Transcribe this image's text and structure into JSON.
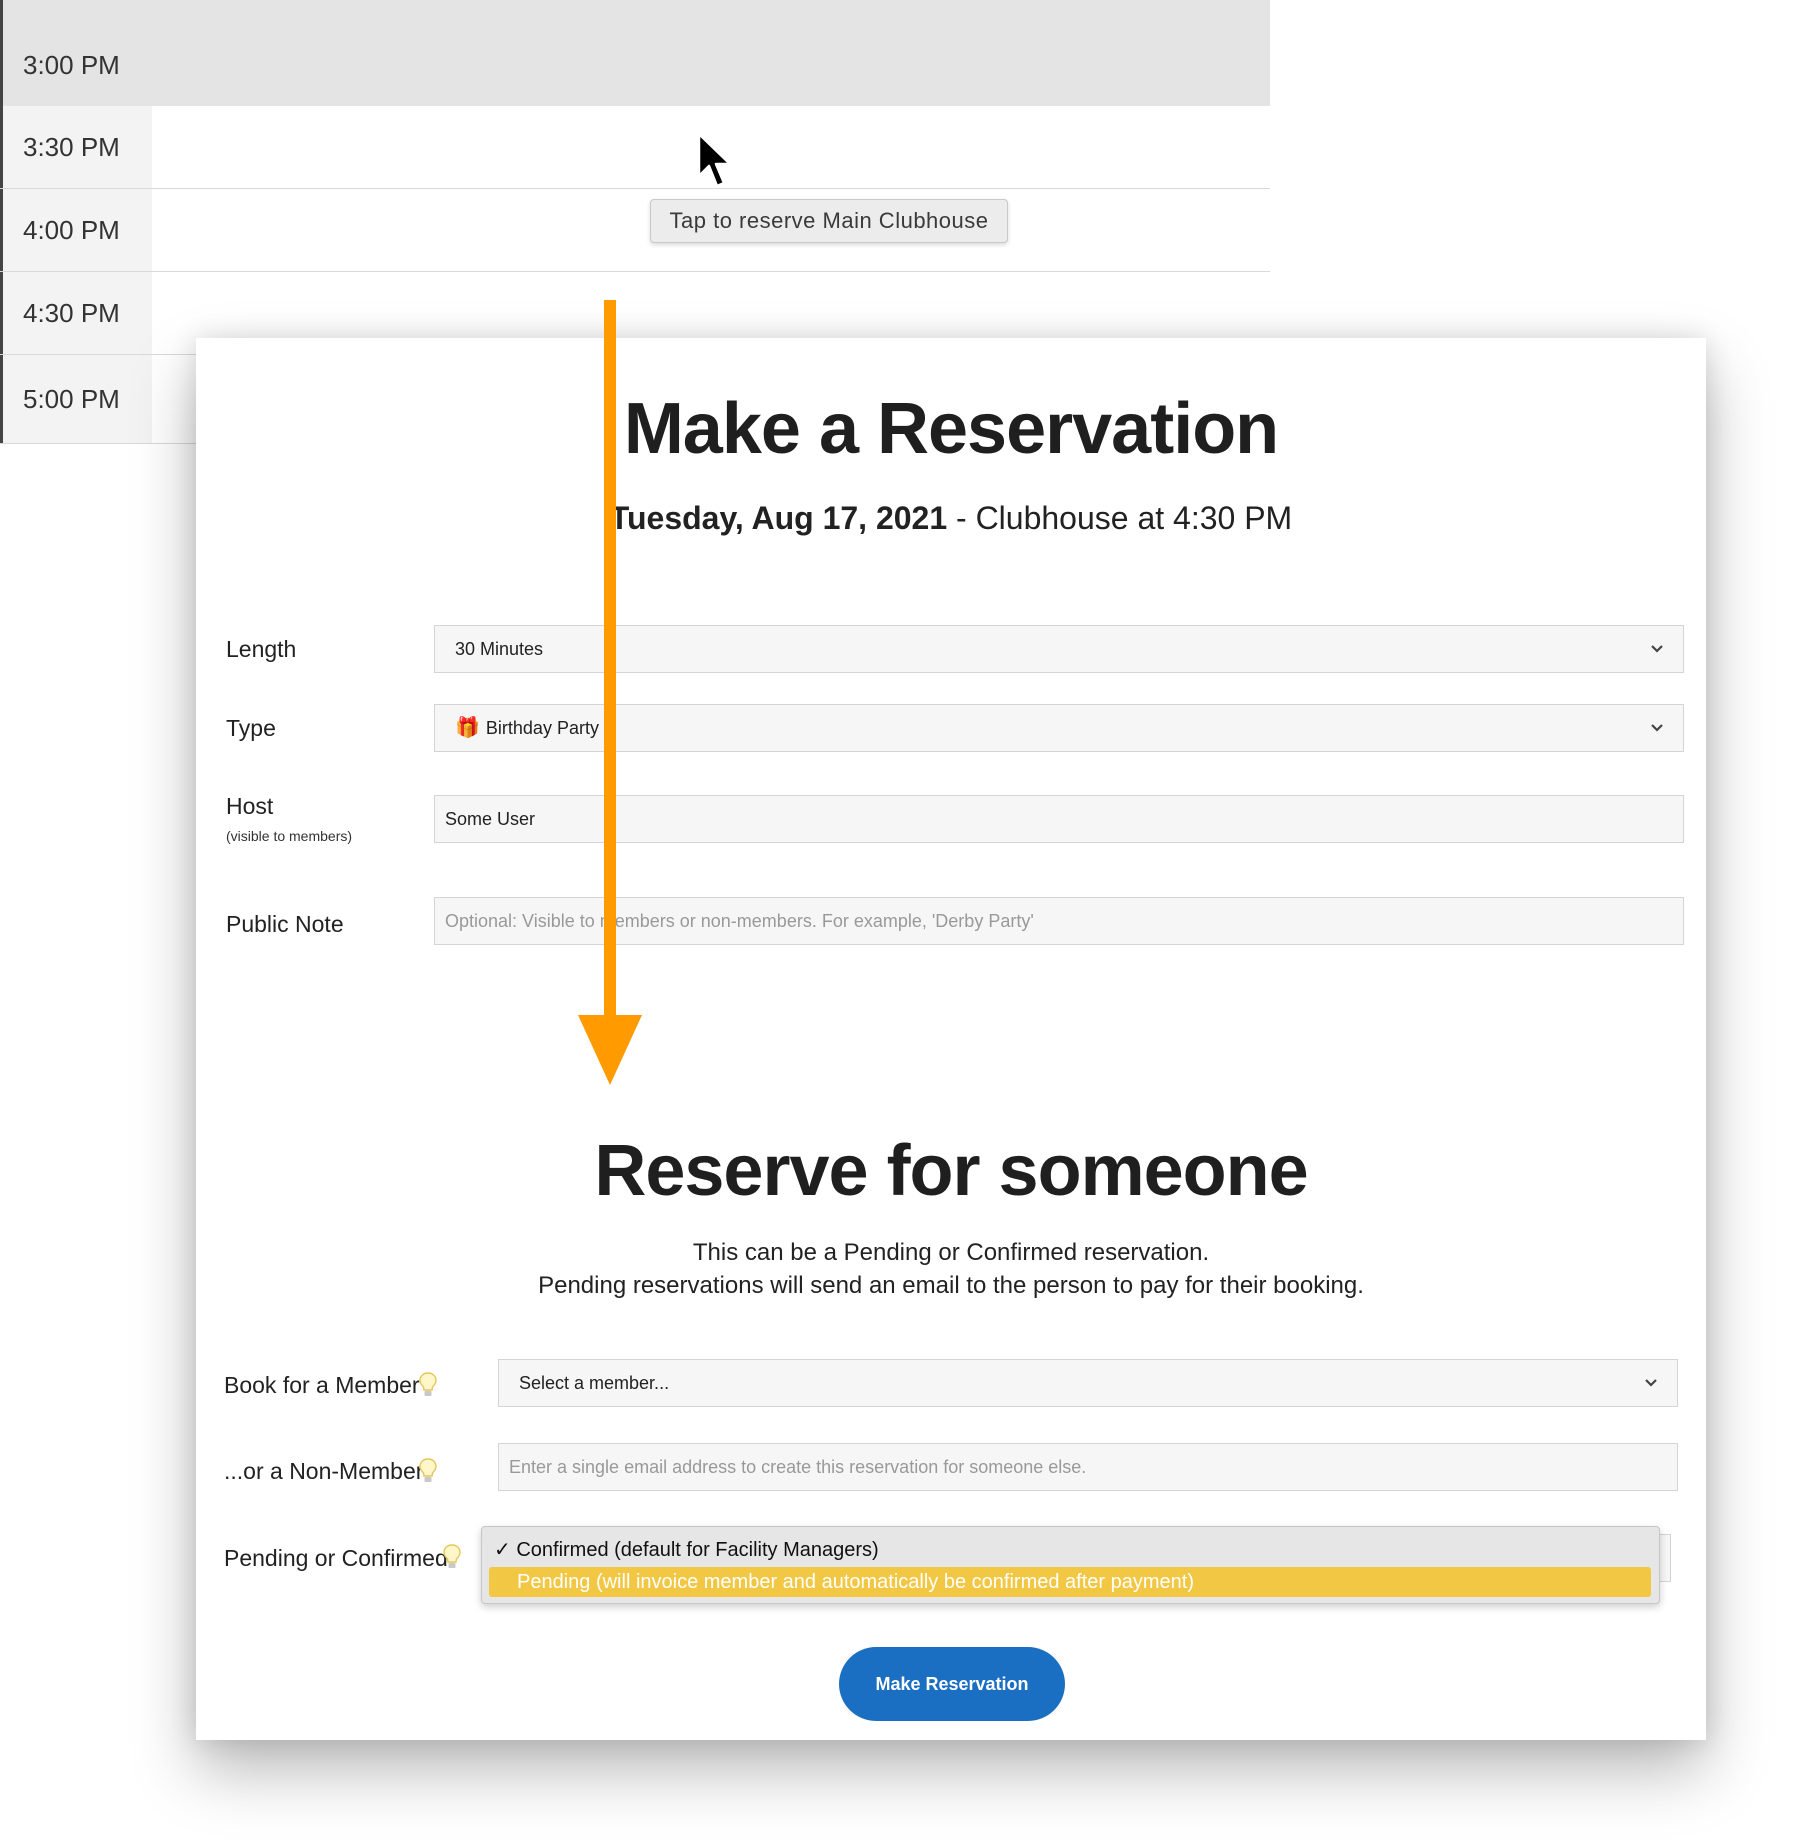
{
  "calendar": {
    "slots": [
      "3:00 PM",
      "3:30 PM",
      "4:00 PM",
      "4:30 PM",
      "5:00 PM"
    ],
    "tooltip": "Tap to reserve Main Clubhouse"
  },
  "modal": {
    "title": "Make a Reservation",
    "date": "Tuesday, Aug 17, 2021",
    "subtitle_rest": " - Clubhouse at 4:30 PM",
    "fields": {
      "length_label": "Length",
      "length_value": "30 Minutes",
      "type_label": "Type",
      "type_icon": "🎁",
      "type_value": "Birthday Party",
      "host_label": "Host",
      "host_hint": "(visible to members)",
      "host_value": "Some User",
      "note_label": "Public Note",
      "note_placeholder": "Optional: Visible to members or non-members. For example, 'Derby Party'"
    },
    "section2": {
      "title": "Reserve for someone",
      "desc_line1": "This can be a Pending or Confirmed reservation.",
      "desc_line2": "Pending reservations will send an email to the person to pay for their booking.",
      "member_label": "Book for a Member",
      "member_placeholder": "Select a member...",
      "nonmember_label": "...or a Non-Member",
      "nonmember_placeholder": "Enter a single email address to create this reservation for someone else.",
      "status_label": "Pending or Confirmed",
      "status_options": [
        "Confirmed (default for Facility Managers)",
        "Pending (will invoice member and automatically be confirmed after payment)"
      ],
      "checkmark": "✓"
    },
    "submit_label": "Make Reservation"
  },
  "colors": {
    "accent_button": "#1b6fc2",
    "highlight_option": "#f2c744",
    "annotation_arrow": "#ff9a00",
    "slot_highlight": "#e4e4e4"
  }
}
